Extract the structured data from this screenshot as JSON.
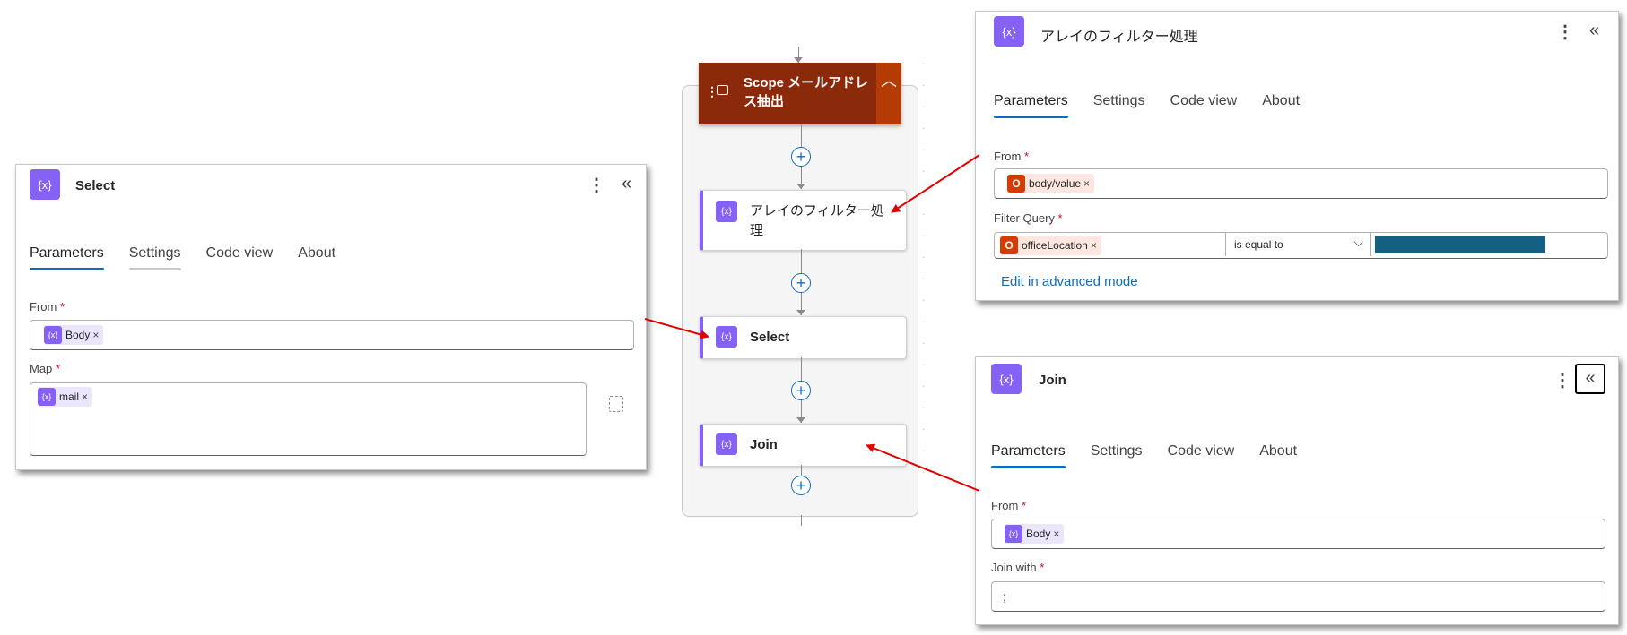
{
  "scope": {
    "title": "Scope メールアドレス抽出",
    "toggle_icon": "chevron-up"
  },
  "flow": {
    "filter_node": "アレイのフィルター処理",
    "select_node": "Select",
    "join_node": "Join",
    "plus": "+"
  },
  "tabs": [
    "Parameters",
    "Settings",
    "Code view",
    "About"
  ],
  "icons": {
    "action": "{x}",
    "more": "⋮",
    "collapse": "«"
  },
  "select_panel": {
    "title": "Select",
    "from_label": "From",
    "from_token": "Body",
    "map_label": "Map",
    "map_token": "mail"
  },
  "filter_panel": {
    "title": "アレイのフィルター処理",
    "from_label": "From",
    "from_token": "body/value",
    "filter_label": "Filter Query",
    "query_token": "officeLocation",
    "operator": "is equal to",
    "advanced_link": "Edit in advanced mode"
  },
  "join_panel": {
    "title": "Join",
    "from_label": "From",
    "from_token": "Body",
    "join_label": "Join with",
    "join_value": ";"
  },
  "required_mark": "*",
  "remove_mark": "×",
  "colors": {
    "action": "#8661f5",
    "scope": "#8a2a0b",
    "accent": "#0f6cbd",
    "arrow": "#e00000",
    "redacted": "#155f82"
  }
}
